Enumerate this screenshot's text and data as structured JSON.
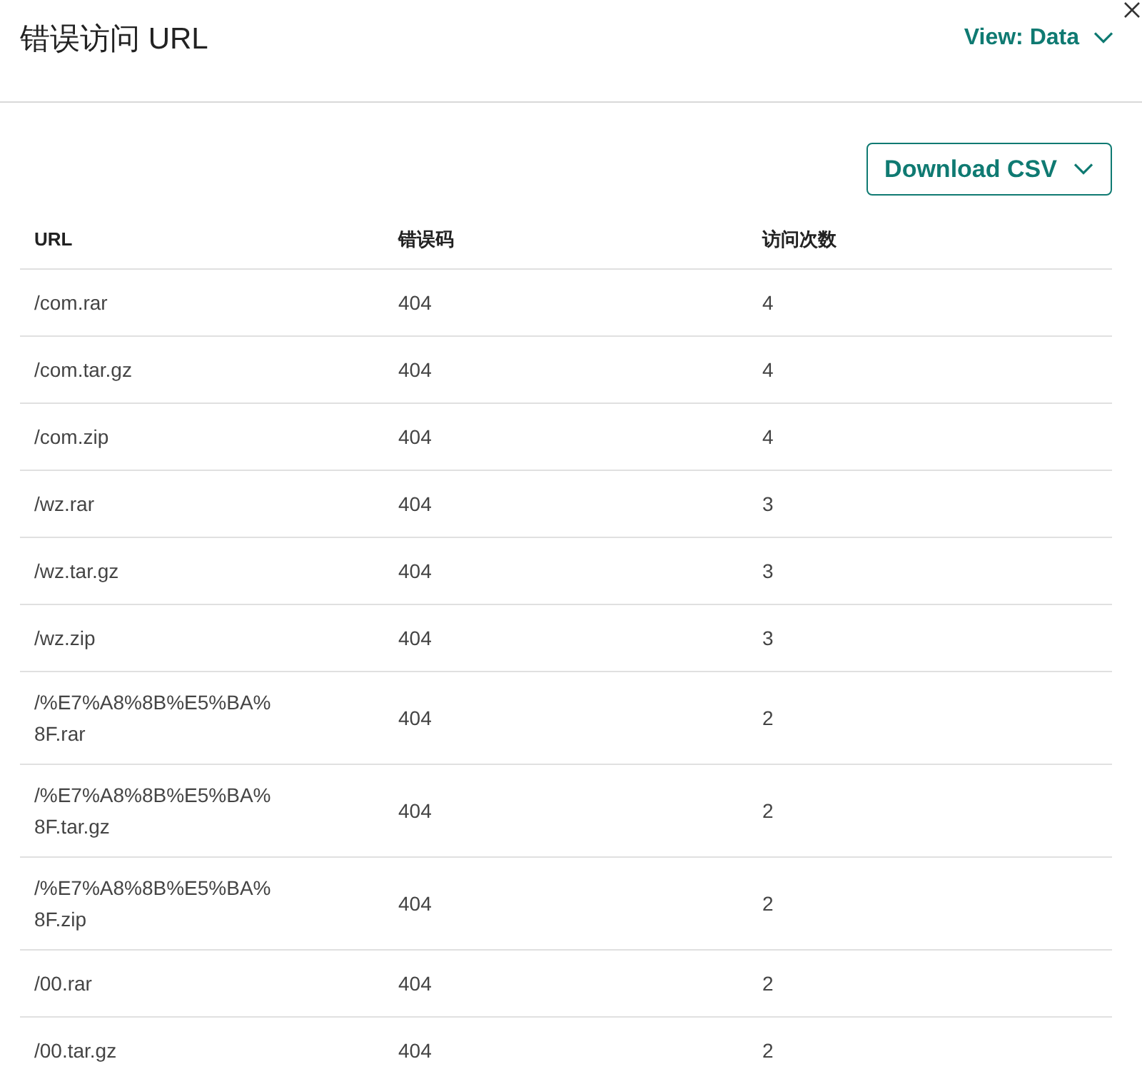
{
  "title": "错误访问 URL",
  "view_menu": {
    "label": "View: Data"
  },
  "download_button": {
    "label": "Download CSV"
  },
  "table": {
    "columns": [
      "URL",
      "错误码",
      "访问次数"
    ],
    "rows": [
      [
        "/com.rar",
        "404",
        "4"
      ],
      [
        "/com.tar.gz",
        "404",
        "4"
      ],
      [
        "/com.zip",
        "404",
        "4"
      ],
      [
        "/wz.rar",
        "404",
        "3"
      ],
      [
        "/wz.tar.gz",
        "404",
        "3"
      ],
      [
        "/wz.zip",
        "404",
        "3"
      ],
      [
        "/%E7%A8%8B%E5%BA%8F.rar",
        "404",
        "2"
      ],
      [
        "/%E7%A8%8B%E5%BA%8F.tar.gz",
        "404",
        "2"
      ],
      [
        "/%E7%A8%8B%E5%BA%8F.zip",
        "404",
        "2"
      ],
      [
        "/00.rar",
        "404",
        "2"
      ],
      [
        "/00.tar.gz",
        "404",
        "2"
      ]
    ]
  }
}
